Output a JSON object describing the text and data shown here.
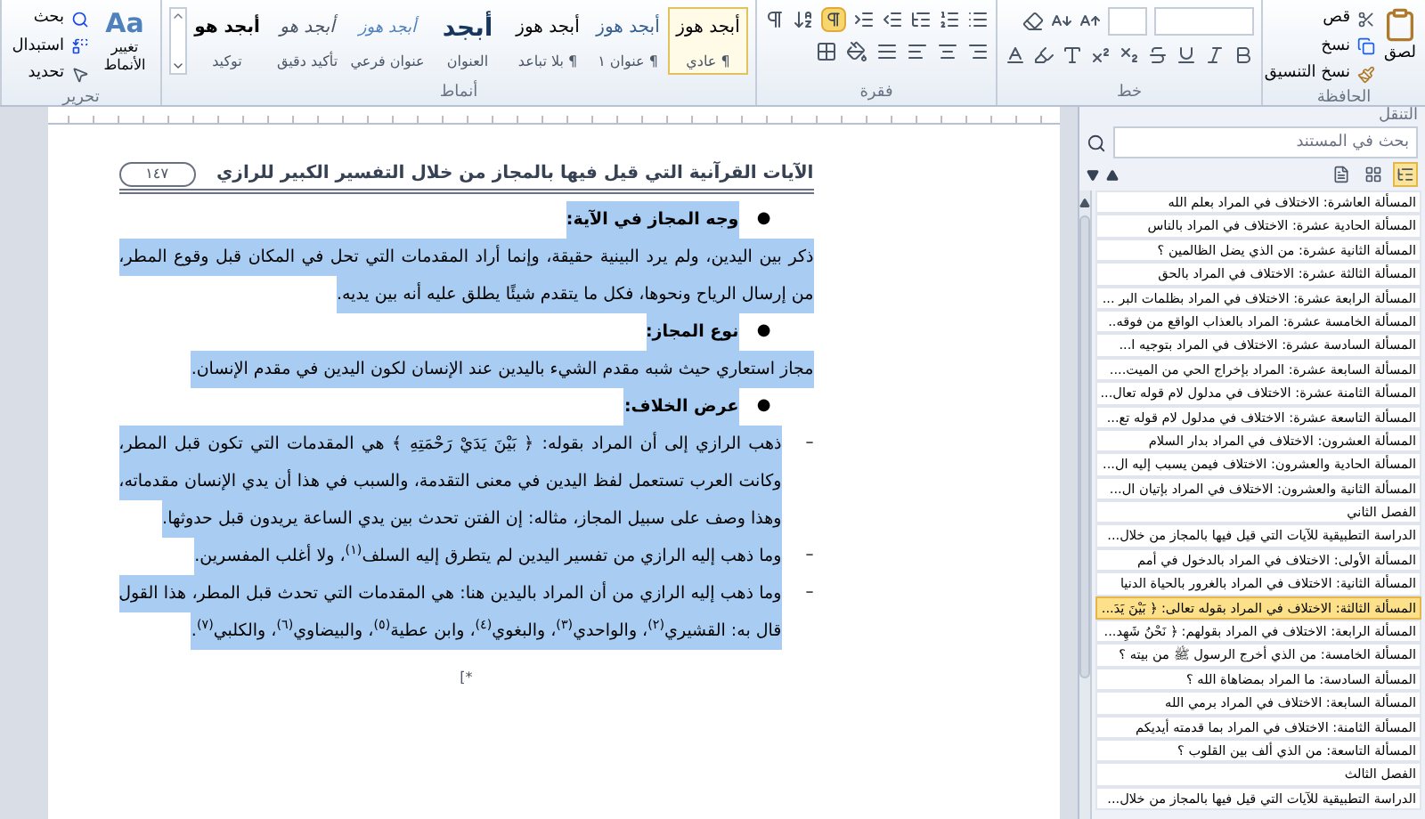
{
  "ribbon": {
    "clipboard": {
      "label": "الحافظة",
      "paste": "لصق",
      "cut": "قص",
      "copy": "نسخ",
      "format_painter": "نسخ التنسيق"
    },
    "font": {
      "label": "خط"
    },
    "paragraph": {
      "label": "فقرة",
      "show_marks_on": true
    },
    "styles": {
      "label": "أنماط",
      "items": [
        {
          "preview": "أبجد هوز",
          "name": "¶ عادي",
          "kind": "normal",
          "selected": true
        },
        {
          "preview": "أبجد هوز",
          "name": "¶ عنوان ١",
          "kind": "heading",
          "selected": false
        },
        {
          "preview": "أبجد هوز",
          "name": "¶ بلا تباعد",
          "kind": "normal",
          "selected": false
        },
        {
          "preview": "أبجد",
          "name": "العنوان",
          "kind": "title",
          "selected": false
        },
        {
          "preview": "أبجد هوز",
          "name": "عنوان فرعي",
          "kind": "subtitle",
          "selected": false
        },
        {
          "preview": "أبجد هو",
          "name": "تأكيد دقيق",
          "kind": "emphasis",
          "selected": false
        },
        {
          "preview": "أبجد هو",
          "name": "توكيد",
          "kind": "strong",
          "selected": false
        }
      ],
      "change_styles": "تغيير الأنماط",
      "change_styles_glyph": "Aa"
    },
    "editing": {
      "label": "تحرير",
      "find": "بحث",
      "replace": "استبدال",
      "select": "تحديد"
    }
  },
  "document": {
    "header_title": "الآيات القرآنية التي قيل فيها بالمجاز من خلال التفسير الكبير للرازي",
    "page_number": "١٤٧",
    "blocks": [
      {
        "kind": "bullet",
        "marker": "●",
        "text": "وجه المجاز في الآية:",
        "selected": true
      },
      {
        "kind": "paragraph",
        "text": "ذكر بين اليدين، ولم يرد البينية حقيقة، وإنما أراد المقدمات التي تحل في المكان قبل وقوع المطر، من إرسال الرياح ونحوها، فكل ما يتقدم شيئًا يطلق عليه أنه بين يديه.",
        "selected": true
      },
      {
        "kind": "bullet",
        "marker": "●",
        "text": "نوع المجاز:",
        "selected": true
      },
      {
        "kind": "paragraph",
        "text": "مجاز استعاري حيث شبه مقدم الشيء باليدين عند الإنسان لكون اليدين في مقدم الإنسان.",
        "selected": true
      },
      {
        "kind": "bullet",
        "marker": "●",
        "text": "عرض الخلاف:",
        "selected": true
      },
      {
        "kind": "dash",
        "marker": "–",
        "text": "ذهب الرازي إلى أن المراد بقوله: ﴿ بَيْنَ يَدَيْ رَحْمَتِهِ ﴾ هي المقدمات التي تكون قبل المطر، وكانت العرب تستعمل لفظ اليدين في معنى التقدمة، والسبب في هذا أن يدي الإنسان مقدماته، وهذا وصف على سبيل المجاز، مثاله: إن الفتن تحدث بين يدي الساعة يريدون قبل حدوثها.",
        "selected": true
      },
      {
        "kind": "dash",
        "marker": "–",
        "text": "وما ذهب إليه الرازي من تفسير اليدين لم يتطرق إليه السلف$^{(١)}$، ولا أغلب المفسرين.",
        "selected": true
      },
      {
        "kind": "dash",
        "marker": "–",
        "text": "وما ذهب إليه الرازي من أن المراد باليدين هنا: هي المقدمات التي تحدث قبل المطر، هذا القول قال به: القشيري$^{(٢)}$، والواحدي$^{(٣)}$، والبغوي$^{(٤)}$، وابن عطية$^{(٥)}$، والبيضاوي$^{(٦)}$، والكلبي$^{(٧)}$.",
        "selected": true
      }
    ],
    "footnote_mark": "*]"
  },
  "navigation": {
    "title": "التنقل",
    "search": {
      "placeholder": "بحث في المستند"
    },
    "view_tabs": [
      {
        "kind": "headings",
        "selected": true
      },
      {
        "kind": "pages",
        "selected": false
      },
      {
        "kind": "results",
        "selected": false
      }
    ],
    "items": [
      {
        "text": "المسألة العاشرة: الاختلاف في المراد بعلم الله",
        "selected": false
      },
      {
        "text": "المسألة الحادية عشرة: الاختلاف في المراد بالناس",
        "selected": false
      },
      {
        "text": "المسألة الثانية عشرة: من الذي يضل الظالمين ؟",
        "selected": false
      },
      {
        "text": "المسألة الثالثة عشرة: الاختلاف في المراد بالحق",
        "selected": false
      },
      {
        "text": "المسألة الرابعة عشرة: الاختلاف في المراد بظلمات البر ...",
        "selected": false
      },
      {
        "text": "المسألة الخامسة عشرة: المراد بالعذاب الواقع من فوقه..",
        "selected": false
      },
      {
        "text": "المسألة السادسة عشرة: الاختلاف في المراد بتوجيه ا...",
        "selected": false
      },
      {
        "text": "المسألة السابعة عشرة: المراد بإخراج الحي من الميت....",
        "selected": false
      },
      {
        "text": "المسألة الثامنة عشرة: الاختلاف في مدلول لام قوله تعال...",
        "selected": false
      },
      {
        "text": "المسألة التاسعة عشرة: الاختلاف في مدلول لام قوله تع...",
        "selected": false
      },
      {
        "text": "المسألة العشرون: الاختلاف في المراد بدار السلام",
        "selected": false
      },
      {
        "text": "المسألة الحادية والعشرون: الاختلاف فيمن يسبب إليه ال...",
        "selected": false
      },
      {
        "text": "المسألة الثانية والعشرون: الاختلاف في المراد بإتيان ال...",
        "selected": false
      },
      {
        "text": "الفصل الثاني",
        "selected": false
      },
      {
        "text": "الدراسة التطبيقية للآيات التي قيل فيها بالمجاز من خلال...",
        "selected": false
      },
      {
        "text": "المسألة الأولى: الاختلاف في المراد بالدخول في أمم",
        "selected": false
      },
      {
        "text": "المسألة الثانية: الاختلاف في المراد بالغرور بالحياة الدنيا",
        "selected": false
      },
      {
        "text": "المسألة الثالثة: الاختلاف في المراد بقوله تعالى: ﴿ بَيْنَ يَدَ...",
        "selected": true
      },
      {
        "text": "المسألة الرابعة: الاختلاف في المراد بقولهم: ﴿ نَحْنُ شَهِد...",
        "selected": false
      },
      {
        "text": "المسألة الخامسة: من الذي أخرج الرسول ﷺ من بيته ؟",
        "selected": false
      },
      {
        "text": "المسألة السادسة: ما المراد بمضاهاة الله ؟",
        "selected": false
      },
      {
        "text": "المسألة السابعة: الاختلاف في المراد برمي الله",
        "selected": false
      },
      {
        "text": "المسألة الثامنة: الاختلاف في المراد بما قدمته أيديكم",
        "selected": false
      },
      {
        "text": "المسألة التاسعة: من الذي ألف بين القلوب ؟",
        "selected": false
      },
      {
        "text": "الفصل الثالث",
        "selected": false
      },
      {
        "text": "الدراسة التطبيقية للآيات التي قيل فيها بالمجاز من خلال...",
        "selected": false
      }
    ]
  }
}
